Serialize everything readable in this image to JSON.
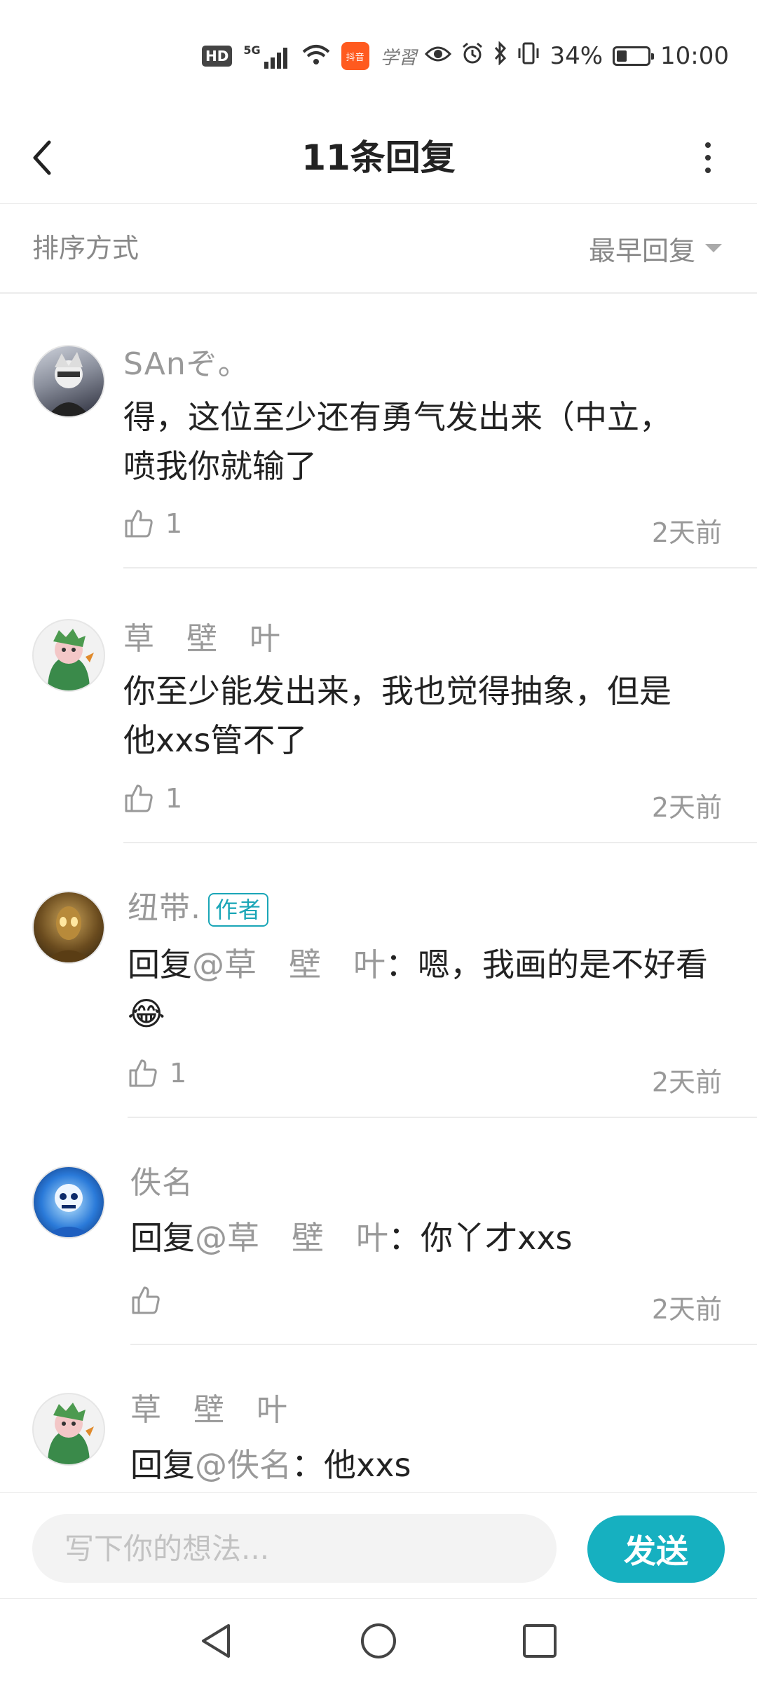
{
  "status_bar": {
    "hd": "HD",
    "net": "5G",
    "app_badge": "抖音",
    "xuexi": "学習",
    "battery": "34%",
    "battery_level": 0.34,
    "time": "10:00"
  },
  "header": {
    "title": "11条回复",
    "icons": [
      "back-icon",
      "more-icon"
    ]
  },
  "sort": {
    "label": "排序方式",
    "selected": "最早回复"
  },
  "comments": [
    {
      "username": "SAnぞ。",
      "text": "得，这位至少还有勇气发出来（中立，\n喷我你就输了",
      "likes": "1",
      "time": "2天前"
    },
    {
      "username": "草　壁　叶",
      "text": "你至少能发出来，我也觉得抽象，但是\n他xxs管不了",
      "likes": "1",
      "time": "2天前"
    },
    {
      "username": "纽带.",
      "author_tag": "作者",
      "reply_prefix": "回复",
      "mention": "@草　壁　叶",
      "text": "：嗯，我画的是不好看",
      "emoji": "😂",
      "likes": "1",
      "time": "2天前"
    },
    {
      "username": "佚名",
      "reply_prefix": "回复",
      "mention": "@草　壁　叶",
      "text": "：你丫才xxs",
      "likes": "",
      "time": "2天前"
    },
    {
      "username": "草　壁　叶",
      "reply_prefix": "回复",
      "mention": "@佚名",
      "text": "：他xxs"
    }
  ],
  "input": {
    "placeholder": "写下你的想法...",
    "send_label": "发送"
  },
  "colors": {
    "accent": "#16b0c0",
    "muted": "#999999",
    "text": "#222222"
  }
}
